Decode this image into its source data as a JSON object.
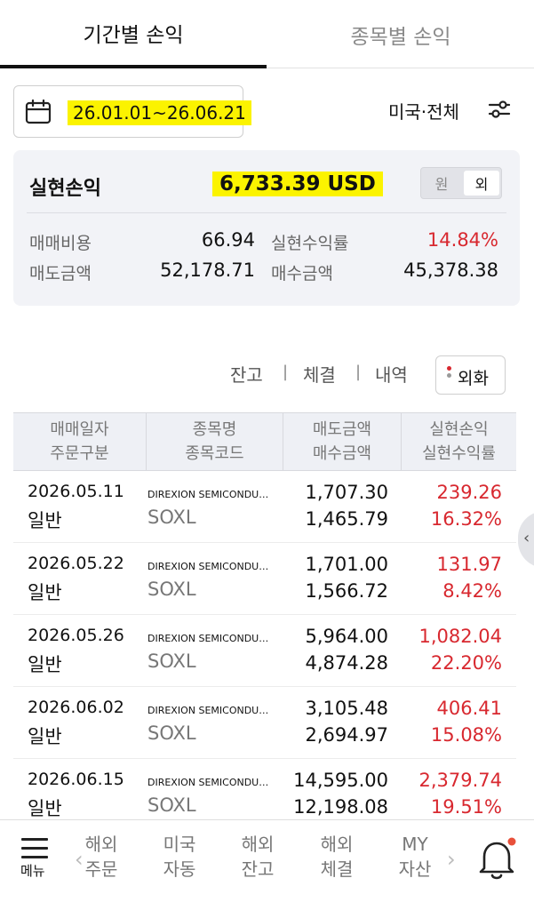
{
  "tabs": {
    "period": "기간별 손익",
    "stock": "종목별 손익"
  },
  "filter": {
    "date_range": "26.01.01~26.06.21",
    "market": "미국·전체"
  },
  "summary": {
    "title": "실현손익",
    "value": "6,733.39 USD",
    "toggle_won": "원",
    "toggle_usd": "외",
    "fee_label": "매매비용",
    "fee_value": "66.94",
    "rate_label": "실현수익률",
    "rate_value": "14.84%",
    "sell_label": "매도금액",
    "sell_value": "52,178.71",
    "buy_label": "매수금액",
    "buy_value": "45,378.38"
  },
  "subtabs": {
    "balance": "잔고",
    "executed": "체결",
    "history": "내역",
    "fx": "외화"
  },
  "table": {
    "headers": {
      "col1_l1": "매매일자",
      "col1_l2": "주문구분",
      "col2_l1": "종목명",
      "col2_l2": "종목코드",
      "col3_l1": "매도금액",
      "col3_l2": "매수금액",
      "col4_l1": "실현손익",
      "col4_l2": "실현수익률"
    },
    "rows": [
      {
        "date": "2026.05.11",
        "type": "일반",
        "name": "DIREXION SEMICONDU…",
        "code": "SOXL",
        "sell": "1,707.30",
        "buy": "1,465.79",
        "pl": "239.26",
        "rate": "16.32%"
      },
      {
        "date": "2026.05.22",
        "type": "일반",
        "name": "DIREXION SEMICONDU…",
        "code": "SOXL",
        "sell": "1,701.00",
        "buy": "1,566.72",
        "pl": "131.97",
        "rate": "8.42%"
      },
      {
        "date": "2026.05.26",
        "type": "일반",
        "name": "DIREXION SEMICONDU…",
        "code": "SOXL",
        "sell": "5,964.00",
        "buy": "4,874.28",
        "pl": "1,082.04",
        "rate": "22.20%"
      },
      {
        "date": "2026.06.02",
        "type": "일반",
        "name": "DIREXION SEMICONDU…",
        "code": "SOXL",
        "sell": "3,105.48",
        "buy": "2,694.97",
        "pl": "406.41",
        "rate": "15.08%"
      },
      {
        "date": "2026.06.15",
        "type": "일반",
        "name": "DIREXION SEMICONDU…",
        "code": "SOXL",
        "sell": "14,595.00",
        "buy": "12,198.08",
        "pl": "2,379.74",
        "rate": "19.51%"
      }
    ]
  },
  "bottom_nav": {
    "menu": "메뉴",
    "items": [
      {
        "l1": "해외",
        "l2": "주문"
      },
      {
        "l1": "미국",
        "l2": "자동"
      },
      {
        "l1": "해외",
        "l2": "잔고"
      },
      {
        "l1": "해외",
        "l2": "체결"
      },
      {
        "l1": "MY",
        "l2": "자산"
      }
    ]
  },
  "colors": {
    "profit": "#d8282f",
    "highlight": "#fbf300",
    "text": "#111111"
  },
  "icons": [
    "calendar-icon",
    "filter-settings-icon",
    "chevron-left-icon",
    "chevron-right-icon",
    "hamburger-menu-icon",
    "bell-icon"
  ]
}
